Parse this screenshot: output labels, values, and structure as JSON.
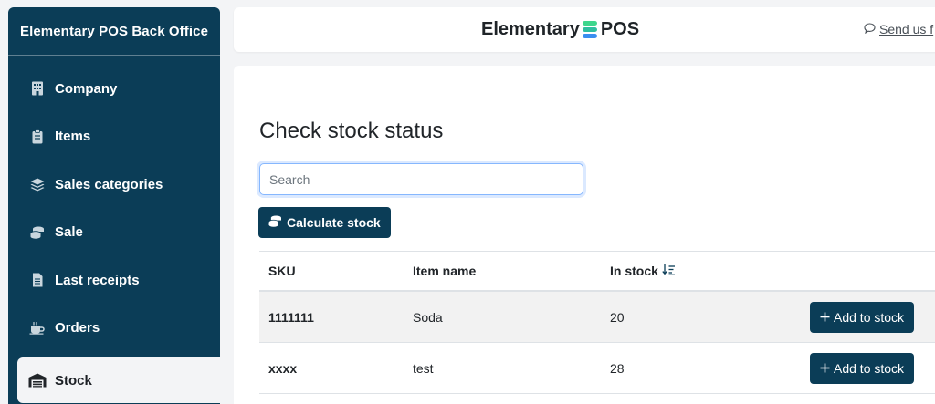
{
  "sidebar": {
    "title": "Elementary POS Back Office",
    "items": [
      {
        "label": "Company",
        "icon": "building-icon"
      },
      {
        "label": "Items",
        "icon": "clipboard-icon"
      },
      {
        "label": "Sales categories",
        "icon": "layers-icon"
      },
      {
        "label": "Sale",
        "icon": "coins-icon"
      },
      {
        "label": "Last receipts",
        "icon": "receipt-icon"
      },
      {
        "label": "Orders",
        "icon": "mug-icon"
      },
      {
        "label": "Stock",
        "icon": "warehouse-icon",
        "active": true
      }
    ]
  },
  "header": {
    "logo_left": "Elementary",
    "logo_right": "POS",
    "logo_colors": [
      "#3dd68c",
      "#2fbf9f",
      "#3a8ef0"
    ],
    "feedback_text": "Send us f"
  },
  "main": {
    "title": "Check stock status",
    "search": {
      "placeholder": "Search",
      "value": ""
    },
    "calculate_label": "Calculate stock",
    "table": {
      "columns": [
        "SKU",
        "Item name",
        "In stock"
      ],
      "rows": [
        {
          "sku": "1111111",
          "name": "Soda",
          "stock": "20",
          "action": "Add to stock"
        },
        {
          "sku": "xxxx",
          "name": "test",
          "stock": "28",
          "action": "Add to stock"
        }
      ]
    }
  },
  "colors": {
    "brand": "#0b3d57",
    "accent_focus": "#86b7fe"
  }
}
